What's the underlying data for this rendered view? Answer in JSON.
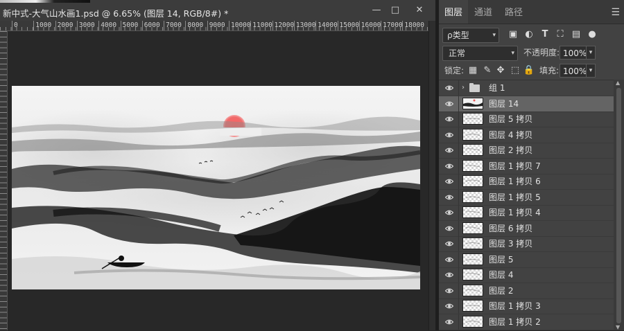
{
  "document": {
    "title": "新中式-大气山水画1.psd @ 6.65% (图层 14, RGB/8#) *",
    "ruler_labels": [
      "0",
      "1000",
      "2000",
      "3000",
      "4000",
      "5000",
      "6000",
      "7000",
      "8000",
      "9000",
      "10000",
      "11000",
      "12000",
      "13000",
      "14000",
      "15000",
      "16000",
      "17000",
      "18000"
    ],
    "window_controls": {
      "minimize": "—",
      "restore": "□",
      "close": "✕"
    }
  },
  "panel": {
    "tabs": [
      {
        "label": "图层",
        "active": true
      },
      {
        "label": "通道",
        "active": false
      },
      {
        "label": "路径",
        "active": false
      }
    ],
    "filter": {
      "kind_label": "ρ类型",
      "icons": [
        "image-filter-icon",
        "adjustment-filter-icon",
        "type-filter-icon",
        "shape-filter-icon",
        "smart-object-filter-icon",
        "filter-toggle-icon"
      ]
    },
    "blend_mode": "正常",
    "opacity_label": "不透明度:",
    "opacity_value": "100%",
    "lock_label": "锁定:",
    "lock_icons": [
      "lock-transparent-icon",
      "lock-image-icon",
      "lock-position-icon",
      "lock-artboard-icon",
      "lock-all-icon"
    ],
    "fill_label": "填充:",
    "fill_value": "100%",
    "layers": [
      {
        "name": "组 1",
        "type": "group",
        "selected": false
      },
      {
        "name": "图层 14",
        "type": "layer",
        "selected": true
      },
      {
        "name": "图层 5 拷贝",
        "type": "layer",
        "selected": false
      },
      {
        "name": "图层 4 拷贝",
        "type": "layer",
        "selected": false
      },
      {
        "name": "图层 2 拷贝",
        "type": "layer",
        "selected": false
      },
      {
        "name": "图层 1 拷贝 7",
        "type": "layer",
        "selected": false
      },
      {
        "name": "图层 1 拷贝 6",
        "type": "layer",
        "selected": false
      },
      {
        "name": "图层 1 拷贝 5",
        "type": "layer",
        "selected": false
      },
      {
        "name": "图层 1 拷贝 4",
        "type": "layer",
        "selected": false
      },
      {
        "name": "图层 6 拷贝",
        "type": "layer",
        "selected": false
      },
      {
        "name": "图层 3 拷贝",
        "type": "layer",
        "selected": false
      },
      {
        "name": "图层 5",
        "type": "layer",
        "selected": false
      },
      {
        "name": "图层 4",
        "type": "layer",
        "selected": false
      },
      {
        "name": "图层 2",
        "type": "layer",
        "selected": false
      },
      {
        "name": "图层 1 拷贝 3",
        "type": "layer",
        "selected": false
      },
      {
        "name": "图层 1 拷贝 2",
        "type": "layer",
        "selected": false
      }
    ]
  },
  "colors": {
    "sun": "#e85a5a",
    "selected_row": "#646464",
    "panel_bg": "#424242"
  }
}
